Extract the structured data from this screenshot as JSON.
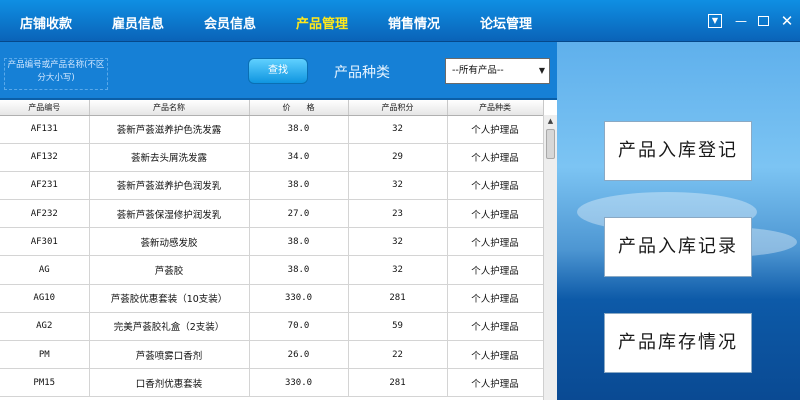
{
  "nav": {
    "items": [
      {
        "label": "店铺收款",
        "active": false
      },
      {
        "label": "雇员信息",
        "active": false
      },
      {
        "label": "会员信息",
        "active": false
      },
      {
        "label": "产品管理",
        "active": true
      },
      {
        "label": "销售情况",
        "active": false
      },
      {
        "label": "论坛管理",
        "active": false
      }
    ],
    "active_color": "#ffe81a"
  },
  "window_controls": {
    "close_glyph": "✕"
  },
  "search": {
    "hint": "产品编号或产品名称(不区分大小写)",
    "button_label": "查找",
    "category_title": "产品种类",
    "category_select_value": "--所有产品--"
  },
  "table": {
    "headers": [
      "产品编号",
      "产品名称",
      "价　　格",
      "产品积分",
      "产品种类"
    ],
    "rows": [
      [
        "AF131",
        "荟新芦荟滋养护色洗发露",
        "38.0",
        "32",
        "个人护理品"
      ],
      [
        "AF132",
        "荟新去头屑洗发露",
        "34.0",
        "29",
        "个人护理品"
      ],
      [
        "AF231",
        "荟新芦荟滋养护色润发乳",
        "38.0",
        "32",
        "个人护理品"
      ],
      [
        "AF232",
        "荟新芦荟保湿修护润发乳",
        "27.0",
        "23",
        "个人护理品"
      ],
      [
        "AF301",
        "荟新动感发胶",
        "38.0",
        "32",
        "个人护理品"
      ],
      [
        "AG",
        "芦荟胶",
        "38.0",
        "32",
        "个人护理品"
      ],
      [
        "AG10",
        "芦荟胶优惠套装（10支装）",
        "330.0",
        "281",
        "个人护理品"
      ],
      [
        "AG2",
        "完美芦荟胶礼盒（2支装）",
        "70.0",
        "59",
        "个人护理品"
      ],
      [
        "PM",
        "芦荟喷雾口香剂",
        "26.0",
        "22",
        "个人护理品"
      ],
      [
        "PM15",
        "口香剂优惠套装",
        "330.0",
        "281",
        "个人护理品"
      ]
    ]
  },
  "side_buttons": [
    "产品入库登记",
    "产品入库记录",
    "产品库存情况"
  ]
}
